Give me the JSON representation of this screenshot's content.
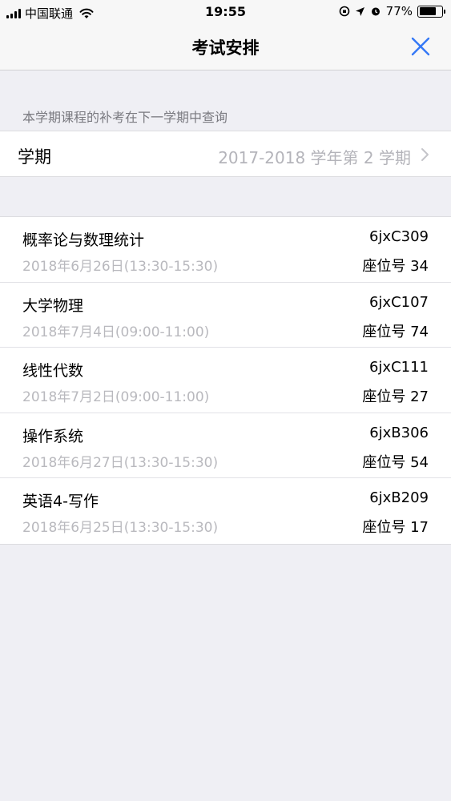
{
  "status_bar": {
    "carrier": "中国联通",
    "time": "19:55",
    "battery": "77%",
    "battery_level": 0.77
  },
  "nav": {
    "title": "考试安排",
    "close_icon": "close-icon",
    "accent_color": "#3478f6"
  },
  "hint": "本学期课程的补考在下一学期中查询",
  "term": {
    "label": "学期",
    "value": "2017-2018 学年第 2 学期"
  },
  "exams": [
    {
      "name": "概率论与数理统计",
      "time": "2018年6月26日(13:30-15:30)",
      "room": "6jxC309",
      "seat": "座位号 34"
    },
    {
      "name": "大学物理",
      "time": "2018年7月4日(09:00-11:00)",
      "room": "6jxC107",
      "seat": "座位号 74"
    },
    {
      "name": "线性代数",
      "time": "2018年7月2日(09:00-11:00)",
      "room": "6jxC111",
      "seat": "座位号 27"
    },
    {
      "name": "操作系统",
      "time": "2018年6月27日(13:30-15:30)",
      "room": "6jxB306",
      "seat": "座位号 54"
    },
    {
      "name": "英语4-写作",
      "time": "2018年6月25日(13:30-15:30)",
      "room": "6jxB209",
      "seat": "座位号 17"
    }
  ]
}
